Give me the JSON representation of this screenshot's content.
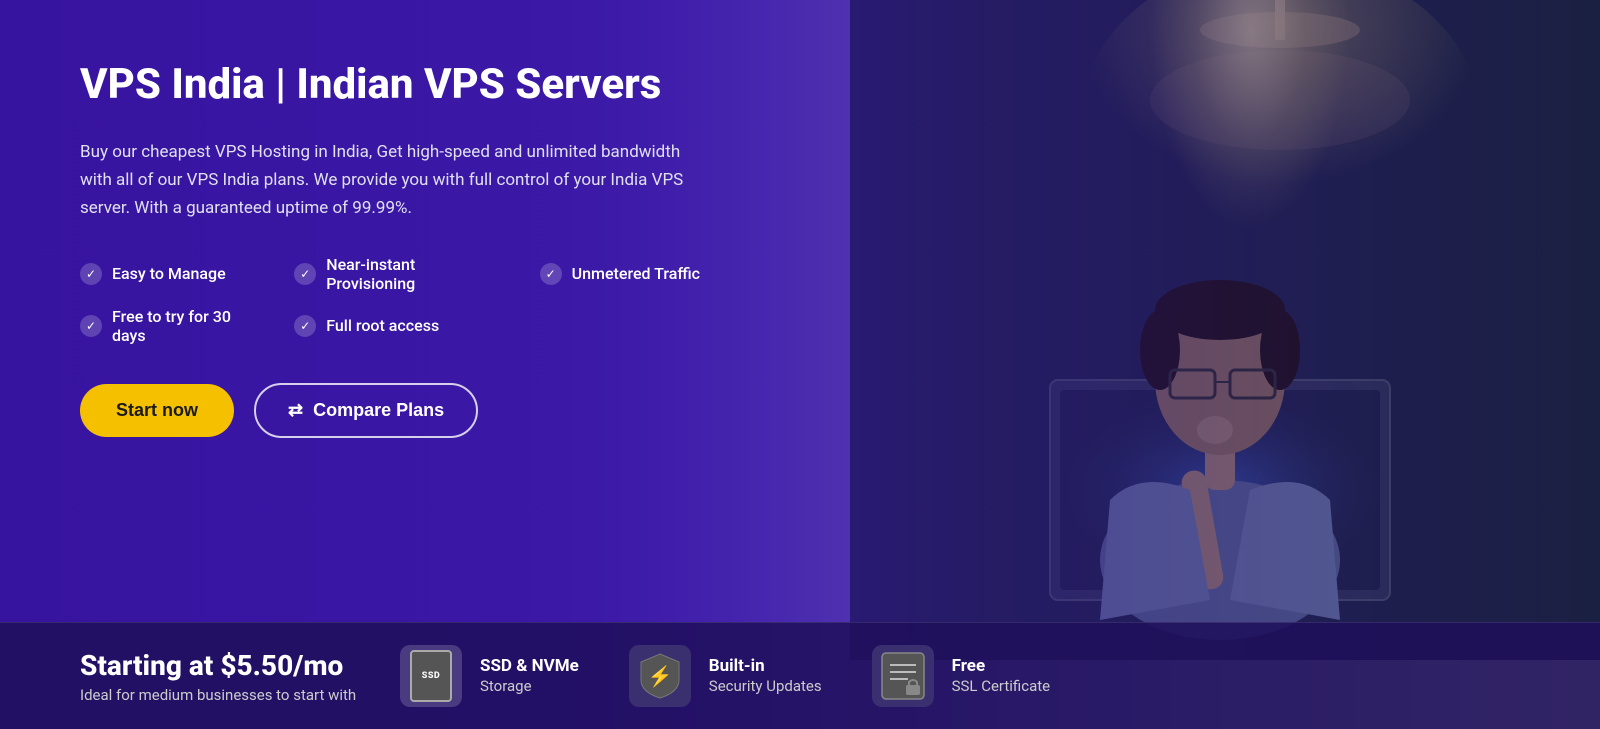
{
  "hero": {
    "title": "VPS India | Indian VPS Servers",
    "description": "Buy our cheapest VPS Hosting in India, Get high-speed and unlimited bandwidth with all of our VPS India plans. We provide you with full control of your India VPS server. With a guaranteed uptime of 99.99%.",
    "features": [
      {
        "id": "easy-manage",
        "label": "Easy to Manage"
      },
      {
        "id": "near-instant",
        "label": "Near-instant Provisioning"
      },
      {
        "id": "unmetered",
        "label": "Unmetered Traffic"
      },
      {
        "id": "free-try",
        "label": "Free to try for 30 days"
      },
      {
        "id": "root-access",
        "label": "Full root access"
      }
    ],
    "buttons": {
      "start": "Start now",
      "compare": "Compare Plans"
    }
  },
  "bottom_bar": {
    "price_label": "Starting at $5.50/mo",
    "price_subtitle": "Ideal for medium businesses to start with",
    "features": [
      {
        "id": "ssd",
        "icon_label": "SSD",
        "title": "SSD & NVMe",
        "subtitle": "Storage"
      },
      {
        "id": "security",
        "icon_label": "⚡",
        "title": "Built-in",
        "subtitle": "Security Updates"
      },
      {
        "id": "ssl",
        "icon_label": "SSL",
        "title": "Free",
        "subtitle": "SSL Certificate"
      }
    ]
  }
}
